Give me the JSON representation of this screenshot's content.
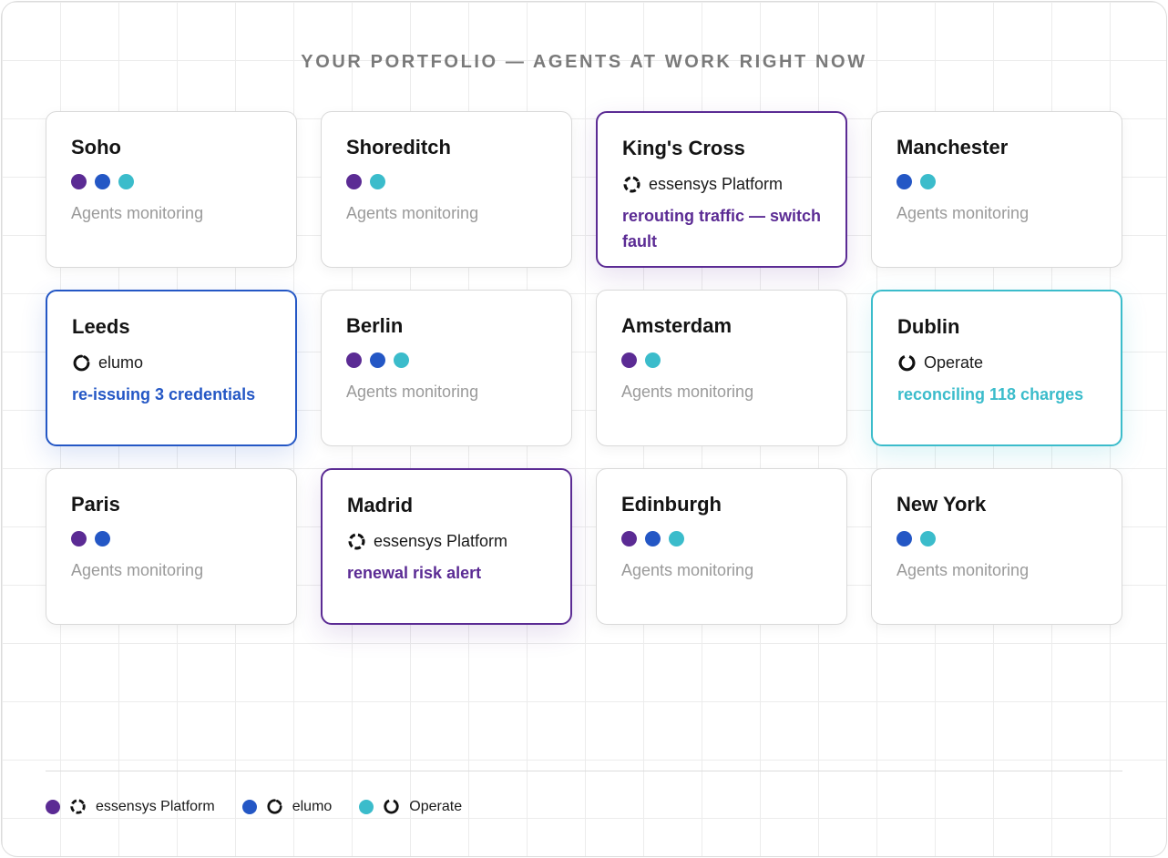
{
  "title": "YOUR PORTFOLIO — AGENTS AT WORK RIGHT NOW",
  "colors": {
    "essensys": "#5b2b94",
    "elumo": "#2457c5",
    "operate": "#3bbccb"
  },
  "products": {
    "essensys": {
      "label": "essensys Platform",
      "icon": "essensys-logo-icon"
    },
    "elumo": {
      "label": "elumo",
      "icon": "elumo-logo-icon"
    },
    "operate": {
      "label": "Operate",
      "icon": "operate-logo-icon"
    }
  },
  "cards": [
    {
      "name": "Soho",
      "status": "Agents monitoring",
      "agents": [
        "essensys",
        "elumo",
        "operate"
      ]
    },
    {
      "name": "Shoreditch",
      "status": "Agents monitoring",
      "agents": [
        "essensys",
        "operate"
      ]
    },
    {
      "name": "King's Cross",
      "active": "essensys",
      "brand": "essensys Platform",
      "task": "rerouting traffic — switch fault"
    },
    {
      "name": "Manchester",
      "status": "Agents monitoring",
      "agents": [
        "elumo",
        "operate"
      ]
    },
    {
      "name": "Leeds",
      "active": "elumo",
      "brand": "elumo",
      "task": "re-issuing 3 credentials"
    },
    {
      "name": "Berlin",
      "status": "Agents monitoring",
      "agents": [
        "essensys",
        "elumo",
        "operate"
      ]
    },
    {
      "name": "Amsterdam",
      "status": "Agents monitoring",
      "agents": [
        "essensys",
        "operate"
      ]
    },
    {
      "name": "Dublin",
      "active": "operate",
      "brand": "Operate",
      "task": "reconciling 118 charges"
    },
    {
      "name": "Paris",
      "status": "Agents monitoring",
      "agents": [
        "essensys",
        "elumo"
      ]
    },
    {
      "name": "Madrid",
      "active": "essensys",
      "brand": "essensys Platform",
      "task": "renewal risk alert"
    },
    {
      "name": "Edinburgh",
      "status": "Agents monitoring",
      "agents": [
        "essensys",
        "elumo",
        "operate"
      ]
    },
    {
      "name": "New York",
      "status": "Agents monitoring",
      "agents": [
        "elumo",
        "operate"
      ]
    }
  ],
  "legend": [
    {
      "key": "essensys",
      "label": "essensys Platform"
    },
    {
      "key": "elumo",
      "label": "elumo"
    },
    {
      "key": "operate",
      "label": "Operate"
    }
  ]
}
